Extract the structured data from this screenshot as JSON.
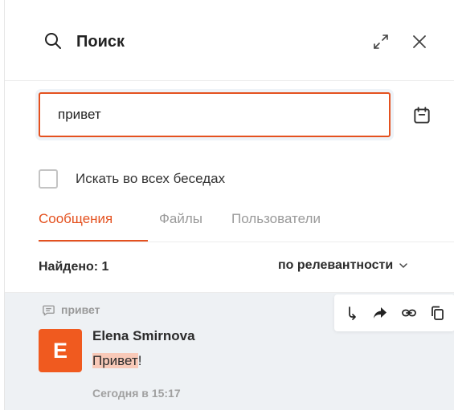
{
  "header": {
    "title": "Поиск",
    "icons": {
      "search": "search-icon",
      "expand": "expand-icon",
      "close": "close-icon"
    }
  },
  "search": {
    "value": "привет",
    "placeholder": ""
  },
  "filters": {
    "all_chats_label": "Искать во всех беседах",
    "all_chats_checked": false
  },
  "tabs": [
    {
      "label": "Сообщения",
      "active": true
    },
    {
      "label": "Файлы",
      "active": false
    },
    {
      "label": "Пользователи",
      "active": false
    }
  ],
  "results": {
    "found_label": "Найдено: 1",
    "sort_label": "по релевантности",
    "items": [
      {
        "chat_name": "привет",
        "avatar_letter": "E",
        "author": "Elena Smirnova",
        "message_highlight": "Привет",
        "message_rest": "!",
        "timestamp": "Сегодня в 15:17"
      }
    ]
  },
  "colors": {
    "accent": "#e4511f",
    "avatar": "#f05a1f",
    "highlight": "#f8c9b8",
    "result_bg": "#eef1f4"
  },
  "actions": [
    "reply-icon",
    "forward-icon",
    "link-icon",
    "copy-icon"
  ]
}
